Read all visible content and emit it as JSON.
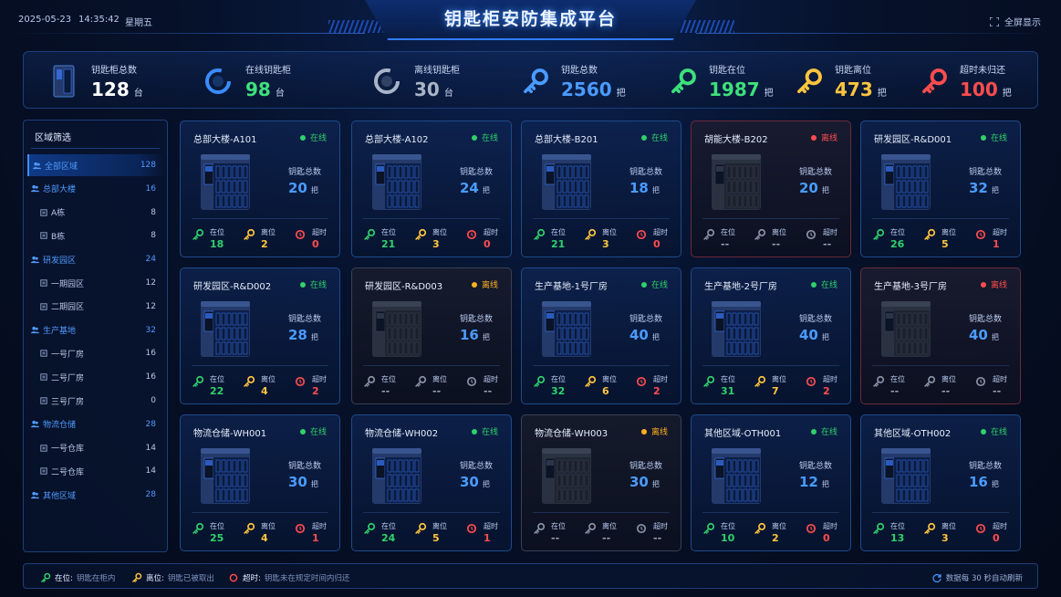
{
  "header": {
    "date": "2025-05-23",
    "time": "14:35:42",
    "weekday": "星期五",
    "title": "钥匙柜安防集成平台",
    "fullscreen_label": "全屏显示"
  },
  "stats": [
    {
      "icon": "cabinet-icon",
      "label": "钥匙柜总数",
      "value": "128",
      "unit": "台",
      "color": "#ffffff"
    },
    {
      "icon": "online-ring-icon",
      "label": "在线钥匙柜",
      "value": "98",
      "unit": "台",
      "color": "#3de07a"
    },
    {
      "icon": "offline-ring-icon",
      "label": "离线钥匙柜",
      "value": "30",
      "unit": "台",
      "color": "#aab3c4"
    },
    {
      "icon": "key-blue-icon",
      "label": "钥匙总数",
      "value": "2560",
      "unit": "把",
      "color": "#4a9bff"
    },
    {
      "icon": "key-green-icon",
      "label": "钥匙在位",
      "value": "1987",
      "unit": "把",
      "color": "#3de07a"
    },
    {
      "icon": "key-yellow-icon",
      "label": "钥匙离位",
      "value": "473",
      "unit": "把",
      "color": "#ffc53d"
    },
    {
      "icon": "key-red-icon",
      "label": "超时未归还",
      "value": "100",
      "unit": "把",
      "color": "#ff4d4f"
    }
  ],
  "sidebar": {
    "title": "区域筛选",
    "items": [
      {
        "label": "全部区域",
        "count": "128",
        "type": "grp",
        "active": true
      },
      {
        "label": "总部大楼",
        "count": "16",
        "type": "grp"
      },
      {
        "label": "A栋",
        "count": "8",
        "type": "sub"
      },
      {
        "label": "B栋",
        "count": "8",
        "type": "sub"
      },
      {
        "label": "研发园区",
        "count": "24",
        "type": "grp"
      },
      {
        "label": "一期园区",
        "count": "12",
        "type": "sub"
      },
      {
        "label": "二期园区",
        "count": "12",
        "type": "sub"
      },
      {
        "label": "生产基地",
        "count": "32",
        "type": "grp"
      },
      {
        "label": "一号厂房",
        "count": "16",
        "type": "sub"
      },
      {
        "label": "二号厂房",
        "count": "16",
        "type": "sub"
      },
      {
        "label": "三号厂房",
        "count": "0",
        "type": "sub"
      },
      {
        "label": "物流仓储",
        "count": "28",
        "type": "grp"
      },
      {
        "label": "一号仓库",
        "count": "14",
        "type": "sub"
      },
      {
        "label": "二号仓库",
        "count": "14",
        "type": "sub"
      },
      {
        "label": "其他区域",
        "count": "28",
        "type": "grp"
      }
    ]
  },
  "card_labels": {
    "total": "钥匙总数",
    "unit": "把",
    "in": "在位",
    "out": "离位",
    "overtime": "超时"
  },
  "status_colors": {
    "online": "#2fd16b",
    "offline": "#ff4d4f",
    "warning": "#ffb020"
  },
  "cabinets": [
    {
      "name": "总部大楼-A101",
      "status": "在线",
      "state": "online",
      "total": "20",
      "in": "18",
      "out": "2",
      "overtime": "0"
    },
    {
      "name": "总部大楼-A102",
      "status": "在线",
      "state": "online",
      "total": "24",
      "in": "21",
      "out": "3",
      "overtime": "0"
    },
    {
      "name": "总部大楼-B201",
      "status": "在线",
      "state": "online",
      "total": "18",
      "in": "21",
      "out": "3",
      "overtime": "0"
    },
    {
      "name": "胡能大楼-B202",
      "status": "离线",
      "state": "offline",
      "total": "20",
      "in": "--",
      "out": "--",
      "overtime": "--"
    },
    {
      "name": "研发园区-R&D001",
      "status": "在线",
      "state": "online",
      "total": "32",
      "in": "26",
      "out": "5",
      "overtime": "1"
    },
    {
      "name": "研发园区-R&D002",
      "status": "在线",
      "state": "online",
      "total": "28",
      "in": "22",
      "out": "4",
      "overtime": "2"
    },
    {
      "name": "研发园区-R&D003",
      "status": "离线",
      "state": "warning",
      "total": "16",
      "in": "--",
      "out": "--",
      "overtime": "--"
    },
    {
      "name": "生产基地-1号厂房",
      "status": "在线",
      "state": "online",
      "total": "40",
      "in": "32",
      "out": "6",
      "overtime": "2"
    },
    {
      "name": "生产基地-2号厂房",
      "status": "在线",
      "state": "online",
      "total": "40",
      "in": "31",
      "out": "7",
      "overtime": "2"
    },
    {
      "name": "生产基地-3号厂房",
      "status": "离线",
      "state": "offline",
      "total": "40",
      "in": "--",
      "out": "--",
      "overtime": "--"
    },
    {
      "name": "物流仓储-WH001",
      "status": "在线",
      "state": "online",
      "total": "30",
      "in": "25",
      "out": "4",
      "overtime": "1"
    },
    {
      "name": "物流仓储-WH002",
      "status": "在线",
      "state": "online",
      "total": "30",
      "in": "24",
      "out": "5",
      "overtime": "1"
    },
    {
      "name": "物流仓储-WH003",
      "status": "离线",
      "state": "warning",
      "total": "30",
      "in": "--",
      "out": "--",
      "overtime": "--"
    },
    {
      "name": "其他区域-OTH001",
      "status": "在线",
      "state": "online",
      "total": "12",
      "in": "10",
      "out": "2",
      "overtime": "0"
    },
    {
      "name": "其他区域-OTH002",
      "status": "在线",
      "state": "online",
      "total": "16",
      "in": "13",
      "out": "3",
      "overtime": "0"
    }
  ],
  "legend": {
    "in_key": "在位:",
    "in_desc": "钥匙在柜内",
    "out_key": "离位:",
    "out_desc": "钥匙已被取出",
    "ot_key": "超时:",
    "ot_desc": "钥匙未在规定时间内归还",
    "refresh": "数据每 30 秒自动刷新"
  }
}
